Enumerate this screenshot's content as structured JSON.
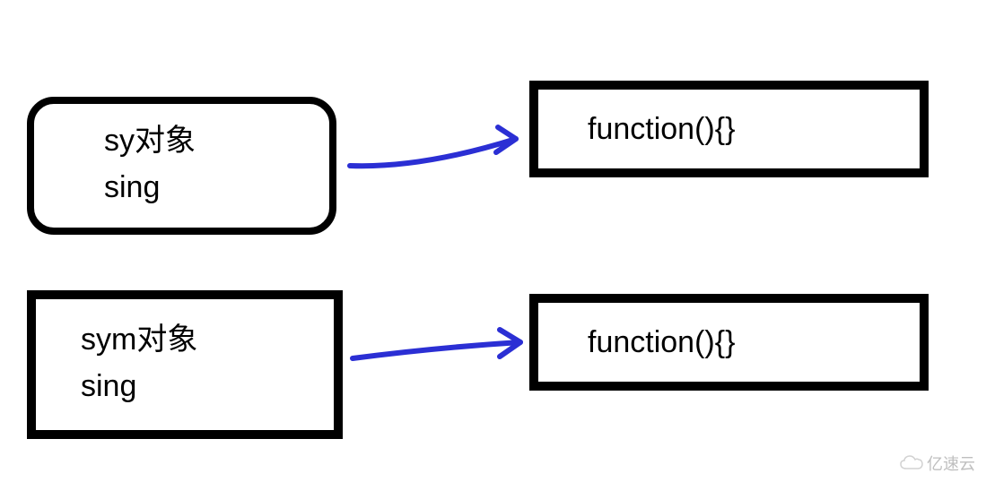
{
  "boxes": {
    "top_left": {
      "line1": "sy对象",
      "line2": "sing"
    },
    "top_right": {
      "text": "function(){}"
    },
    "bottom_left": {
      "line1": "sym对象",
      "line2": "sing"
    },
    "bottom_right": {
      "text": "function(){}"
    }
  },
  "arrows": {
    "top": {
      "from": "top_left",
      "to": "top_right",
      "color": "#2b2fd4"
    },
    "bottom": {
      "from": "bottom_left",
      "to": "bottom_right",
      "color": "#2b2fd4"
    }
  },
  "watermark": {
    "text": "亿速云"
  }
}
